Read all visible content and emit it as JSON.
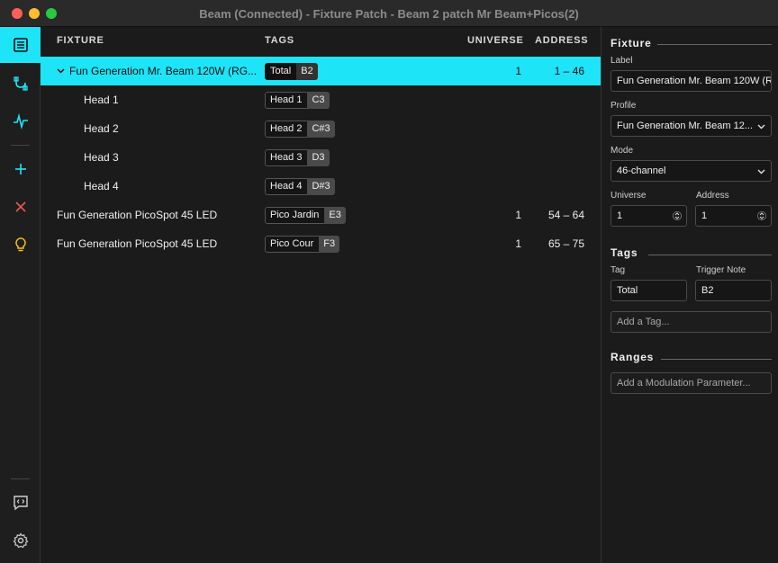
{
  "window": {
    "title": "Beam (Connected) - Fixture Patch - Beam 2 patch Mr Beam+Picos(2)"
  },
  "sidebar": {
    "items": [
      {
        "icon": "list-icon",
        "active": true
      },
      {
        "icon": "patch-cable-icon",
        "active": false
      },
      {
        "icon": "pulse-icon",
        "active": false
      },
      {
        "icon": "plus-icon",
        "active": false
      },
      {
        "icon": "x-icon",
        "active": false
      },
      {
        "icon": "lightbulb-icon",
        "active": false
      },
      {
        "icon": "code-feedback-icon",
        "active": false
      },
      {
        "icon": "gear-icon",
        "active": false
      }
    ],
    "colors": {
      "active_bg": "#1ee4f8",
      "icon": "#1ee4f8",
      "delete": "#e85a52",
      "bulb": "#f5c518"
    }
  },
  "columns": {
    "fixture": "FIXTURE",
    "tags": "TAGS",
    "universe": "UNIVERSE",
    "address": "ADDRESS"
  },
  "rows": [
    {
      "name": "Fun Generation Mr. Beam 120W (RG...",
      "tag": "Total",
      "note": "B2",
      "universe": "1",
      "address": "1 – 46",
      "selected": true,
      "expandable": true
    },
    {
      "name": "Head 1",
      "tag": "Head 1",
      "note": "C3",
      "universe": "",
      "address": ""
    },
    {
      "name": "Head 2",
      "tag": "Head 2",
      "note": "C#3",
      "universe": "",
      "address": ""
    },
    {
      "name": "Head 3",
      "tag": "Head 3",
      "note": "D3",
      "universe": "",
      "address": ""
    },
    {
      "name": "Head 4",
      "tag": "Head 4",
      "note": "D#3",
      "universe": "",
      "address": ""
    },
    {
      "name": "Fun Generation PicoSpot 45 LED",
      "tag": "Pico Jardin",
      "note": "E3",
      "universe": "1",
      "address": "54 – 64"
    },
    {
      "name": "Fun Generation PicoSpot 45 LED",
      "tag": "Pico Cour",
      "note": "F3",
      "universe": "1",
      "address": "65 – 75"
    }
  ],
  "inspector": {
    "fixture": {
      "title": "Fixture",
      "label_label": "Label",
      "label_value": "Fun Generation Mr. Beam 120W (R",
      "profile_label": "Profile",
      "profile_value": "Fun Generation Mr. Beam 12...",
      "mode_label": "Mode",
      "mode_value": "46-channel",
      "universe_label": "Universe",
      "universe_value": "1",
      "address_label": "Address",
      "address_value": "1"
    },
    "tags": {
      "title": "Tags",
      "tag_label": "Tag",
      "note_label": "Trigger Note",
      "tag_value": "Total",
      "note_value": "B2",
      "add_placeholder": "Add a Tag..."
    },
    "ranges": {
      "title": "Ranges",
      "add_placeholder": "Add a Modulation Parameter..."
    }
  }
}
